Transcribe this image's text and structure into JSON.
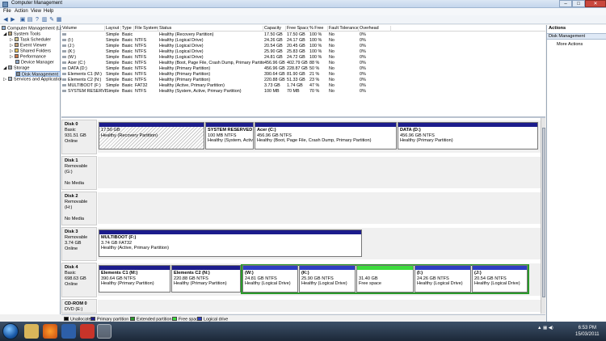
{
  "window": {
    "title": "Computer Management",
    "min": "–",
    "max": "□",
    "close": "✕"
  },
  "menu": [
    "File",
    "Action",
    "View",
    "Help"
  ],
  "toolbar_icons": [
    "back-icon",
    "forward-icon",
    "up-icon",
    "properties-icon",
    "help-icon",
    "console-icon",
    "refresh-icon",
    "view-icon"
  ],
  "tree": [
    {
      "label": "Computer Management (Lo",
      "icon": "computer-icon"
    },
    {
      "label": "System Tools",
      "icon": "tools-icon"
    },
    {
      "label": "Task Scheduler",
      "icon": "clock-icon"
    },
    {
      "label": "Event Viewer",
      "icon": "event-icon"
    },
    {
      "label": "Shared Folders",
      "icon": "folder-icon"
    },
    {
      "label": "Performance",
      "icon": "performance-icon"
    },
    {
      "label": "Device Manager",
      "icon": "device-icon"
    },
    {
      "label": "Storage",
      "icon": "storage-icon"
    },
    {
      "label": "Disk Management",
      "icon": "disk-icon"
    },
    {
      "label": "Services and Applications",
      "icon": "services-icon"
    }
  ],
  "volumes": {
    "headers": [
      "Volume",
      "Layout",
      "Type",
      "File System",
      "Status",
      "Capacity",
      "Free Space",
      "% Free",
      "Fault Tolerance",
      "Overhead"
    ],
    "rows": [
      [
        "",
        "Simple",
        "Basic",
        "",
        "Healthy (Recovery Partition)",
        "17.50 GB",
        "17.50 GB",
        "100 %",
        "No",
        "0%"
      ],
      [
        "(I:)",
        "Simple",
        "Basic",
        "NTFS",
        "Healthy (Logical Drive)",
        "24.26 GB",
        "24.17 GB",
        "100 %",
        "No",
        "0%"
      ],
      [
        "(J:)",
        "Simple",
        "Basic",
        "NTFS",
        "Healthy (Logical Drive)",
        "20.54 GB",
        "20.45 GB",
        "100 %",
        "No",
        "0%"
      ],
      [
        "(K:)",
        "Simple",
        "Basic",
        "NTFS",
        "Healthy (Logical Drive)",
        "25.90 GB",
        "25.83 GB",
        "100 %",
        "No",
        "0%"
      ],
      [
        "(W:)",
        "Simple",
        "Basic",
        "NTFS",
        "Healthy (Logical Drive)",
        "24.81 GB",
        "24.72 GB",
        "100 %",
        "No",
        "0%"
      ],
      [
        "Acer (C:)",
        "Simple",
        "Basic",
        "NTFS",
        "Healthy (Boot, Page File, Crash Dump, Primary Partition)",
        "456.96 GB",
        "402.79 GB",
        "88 %",
        "No",
        "0%"
      ],
      [
        "DATA (D:)",
        "Simple",
        "Basic",
        "NTFS",
        "Healthy (Primary Partition)",
        "456.96 GB",
        "228.87 GB",
        "50 %",
        "No",
        "0%"
      ],
      [
        "Elements C1 (M:)",
        "Simple",
        "Basic",
        "NTFS",
        "Healthy (Primary Partition)",
        "390.64 GB",
        "81.90 GB",
        "21 %",
        "No",
        "0%"
      ],
      [
        "Elements C2 (N:)",
        "Simple",
        "Basic",
        "NTFS",
        "Healthy (Primary Partition)",
        "220.88 GB",
        "51.33 GB",
        "23 %",
        "No",
        "0%"
      ],
      [
        "MULTIBOOT (F:)",
        "Simple",
        "Basic",
        "FAT32",
        "Healthy (Active, Primary Partition)",
        "3.73 GB",
        "1.74 GB",
        "47 %",
        "No",
        "0%"
      ],
      [
        "SYSTEM RESERVED",
        "Simple",
        "Basic",
        "NTFS",
        "Healthy (System, Active, Primary Partition)",
        "100 MB",
        "70 MB",
        "70 %",
        "No",
        "0%"
      ]
    ]
  },
  "disks": [
    {
      "name": "Disk 0",
      "lines": [
        "Basic",
        "931.51 GB",
        "Online"
      ],
      "partitions": [
        {
          "name": "",
          "size": "17.50 GB",
          "status": "Healthy (Recovery Partition)",
          "kind": "primary",
          "hatched": true
        },
        {
          "name": "SYSTEM RESERVED",
          "size": "100 MB NTFS",
          "status": "Healthy (System, Active, I",
          "kind": "primary"
        },
        {
          "name": "Acer  (C:)",
          "size": "456.96 GB NTFS",
          "status": "Healthy (Boot, Page File, Crash Dump, Primary Partition)",
          "kind": "primary"
        },
        {
          "name": "DATA  (D:)",
          "size": "456.96 GB NTFS",
          "status": "Healthy (Primary Partition)",
          "kind": "primary"
        }
      ]
    },
    {
      "name": "Disk 1",
      "lines": [
        "Removable (G:)",
        "",
        "No Media"
      ],
      "partitions": []
    },
    {
      "name": "Disk 2",
      "lines": [
        "Removable (H:)",
        "",
        "No Media"
      ],
      "partitions": []
    },
    {
      "name": "Disk 3",
      "lines": [
        "Removable",
        "3.74 GB",
        "Online"
      ],
      "partitions": [
        {
          "name": "MULTIBOOT  (F:)",
          "size": "3.74 GB FAT32",
          "status": "Healthy (Active, Primary Partition)",
          "kind": "primary"
        }
      ]
    },
    {
      "name": "Disk 4",
      "lines": [
        "Basic",
        "698.63 GB",
        "Online"
      ],
      "partitions": [
        {
          "name": "Elements C1  (M:)",
          "size": "390.64 GB NTFS",
          "status": "Healthy (Primary Partition)",
          "kind": "primary"
        },
        {
          "name": "Elements C2  (N:)",
          "size": "220.88 GB NTFS",
          "status": "Healthy (Primary Partition)",
          "kind": "primary"
        },
        {
          "name": "(W:)",
          "size": "24.81 GB NTFS",
          "status": "Healthy (Logical Drive)",
          "kind": "logical"
        },
        {
          "name": "(K:)",
          "size": "25.90 GB NTFS",
          "status": "Healthy (Logical Drive)",
          "kind": "logical"
        },
        {
          "name": "",
          "size": "31.40 GB",
          "status": "Free space",
          "kind": "free"
        },
        {
          "name": "(I:)",
          "size": "24.26 GB NTFS",
          "status": "Healthy (Logical Drive)",
          "kind": "logical"
        },
        {
          "name": "(J:)",
          "size": "20.54 GB NTFS",
          "status": "Healthy (Logical Drive)",
          "kind": "logical"
        }
      ]
    },
    {
      "name": "CD-ROM 0",
      "lines": [
        "DVD (E:)",
        "",
        ""
      ],
      "partitions": []
    }
  ],
  "legend": [
    {
      "label": "Unallocated",
      "color": "#000000"
    },
    {
      "label": "Primary partition",
      "color": "#1c1c8c"
    },
    {
      "label": "Extended partition",
      "color": "#2a9a2a"
    },
    {
      "label": "Free space",
      "color": "#3cdc3c"
    },
    {
      "label": "Logical drive",
      "color": "#2e3fc4"
    }
  ],
  "actions": {
    "header": "Actions",
    "section": "Disk Management",
    "more": "More Actions"
  },
  "taskbar": {
    "apps": [
      "explorer-icon",
      "firefox-icon",
      "media-player-icon",
      "stop-icon",
      "computer-management-icon"
    ],
    "clock_time": "6:53 PM",
    "clock_date": "15/03/2011"
  }
}
